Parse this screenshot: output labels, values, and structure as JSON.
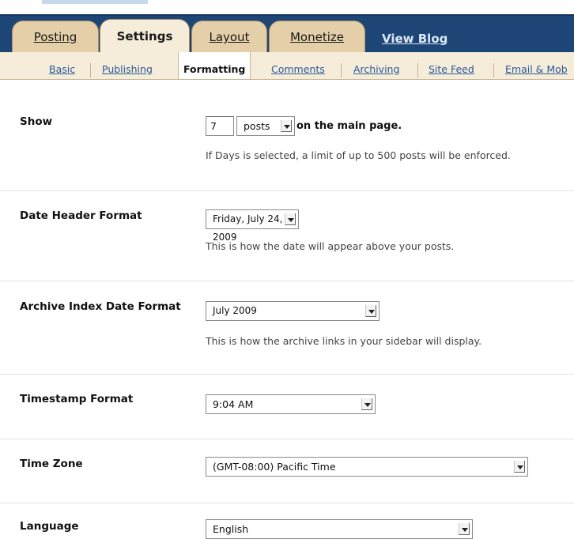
{
  "main_tabs": [
    {
      "label": "Posting"
    },
    {
      "label": "Settings"
    },
    {
      "label": "Layout"
    },
    {
      "label": "Monetize"
    }
  ],
  "view_blog": "View Blog",
  "sub_tabs": [
    {
      "label": "Basic"
    },
    {
      "label": "Publishing"
    },
    {
      "label": "Formatting"
    },
    {
      "label": "Comments"
    },
    {
      "label": "Archiving"
    },
    {
      "label": "Site Feed"
    },
    {
      "label": "Email & Mob"
    }
  ],
  "settings": {
    "show": {
      "label": "Show",
      "count_value": "7",
      "unit_selected": "posts",
      "suffix": "on the main page.",
      "help": "If Days is selected, a limit of up to 500 posts will be enforced."
    },
    "date_header": {
      "label": "Date Header Format",
      "selected": "Friday, July 24, 2009",
      "help": "This is how the date will appear above your posts."
    },
    "archive_index": {
      "label": "Archive Index Date Format",
      "selected": "July 2009",
      "help": "This is how the archive links in your sidebar will display."
    },
    "timestamp": {
      "label": "Timestamp Format",
      "selected": "9:04 AM"
    },
    "time_zone": {
      "label": "Time Zone",
      "selected": "(GMT-08:00) Pacific Time"
    },
    "language": {
      "label": "Language",
      "selected": "English"
    }
  },
  "colors": {
    "nav_background": "#1d4677",
    "tab_tan": "#e4cfa9",
    "tab_active": "#f5ecd9",
    "link_blue": "#2a5a9a"
  }
}
